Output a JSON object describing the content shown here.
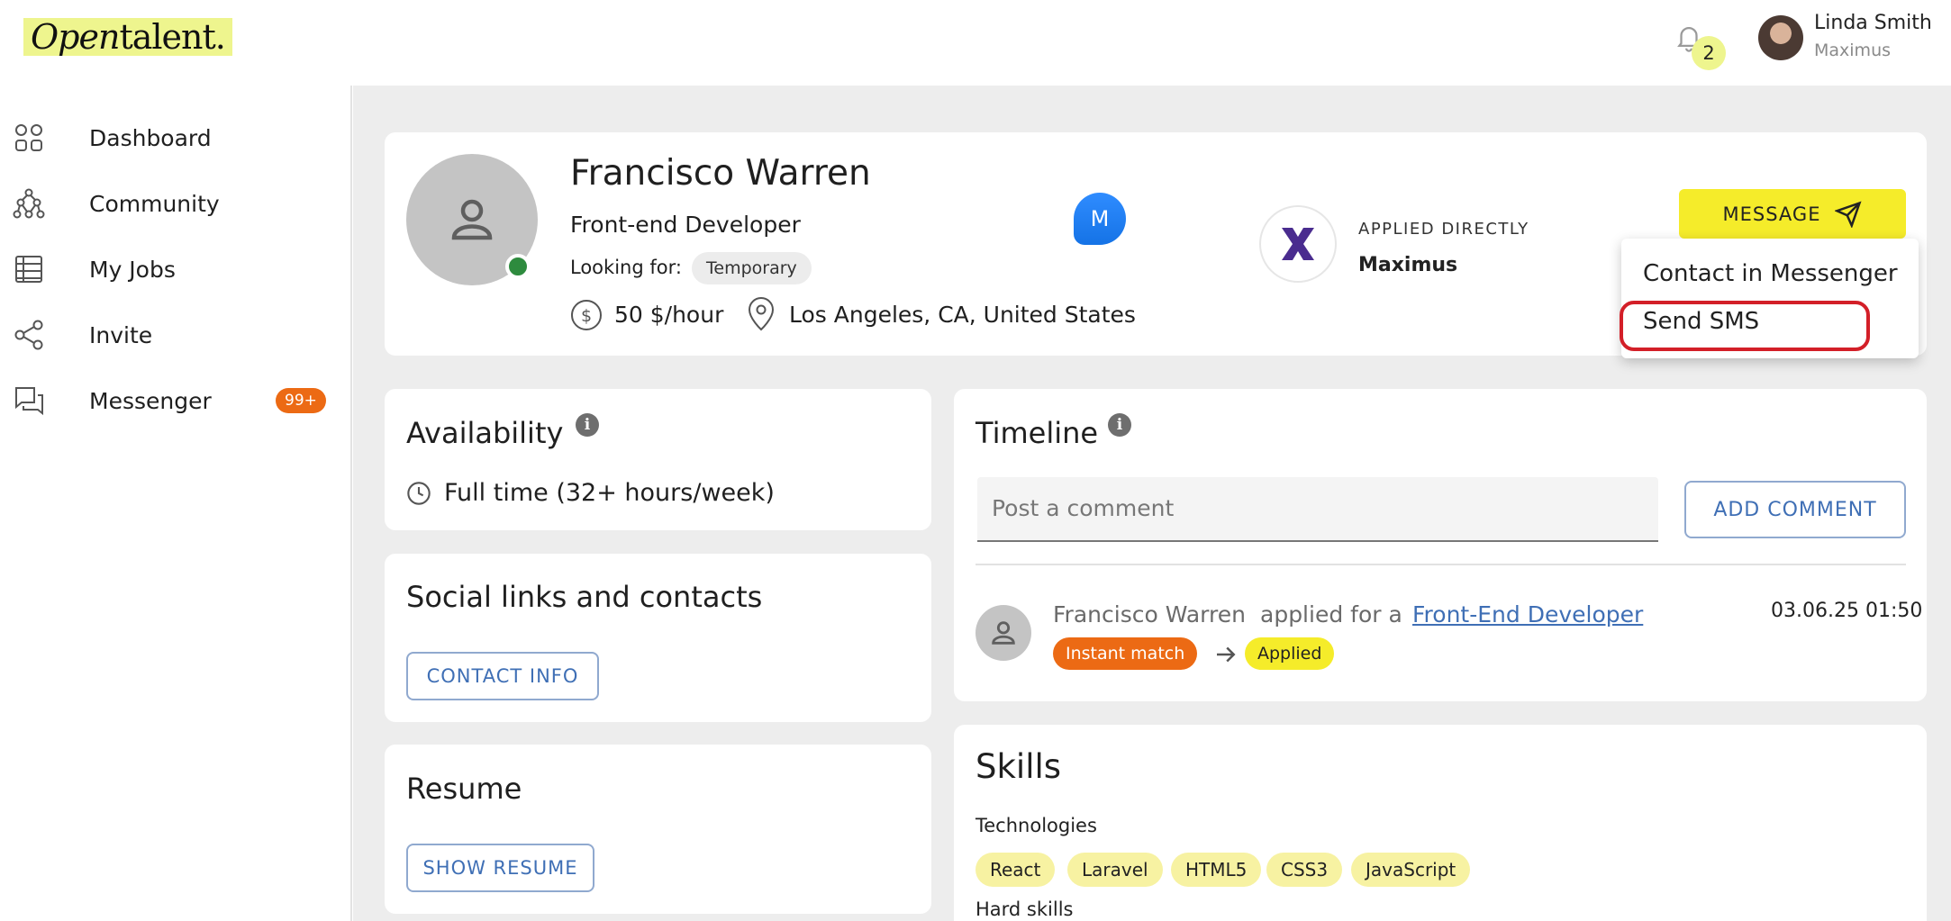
{
  "header": {
    "logo_text_italic": "Open",
    "logo_text_rest": "talent.",
    "notification_count": "2",
    "user_name": "Linda Smith",
    "user_org": "Maximus"
  },
  "sidebar": {
    "items": [
      {
        "label": "Dashboard",
        "icon": "dashboard-icon"
      },
      {
        "label": "Community",
        "icon": "community-icon"
      },
      {
        "label": "My Jobs",
        "icon": "jobs-icon"
      },
      {
        "label": "Invite",
        "icon": "share-icon"
      },
      {
        "label": "Messenger",
        "icon": "chat-icon",
        "badge": "99+"
      }
    ]
  },
  "profile": {
    "name": "Francisco Warren",
    "role": "Front-end Developer",
    "looking_label": "Looking for:",
    "looking_value": "Temporary",
    "rate": "50 $/hour",
    "location": "Los Angeles, CA, United States",
    "messenger_initial": "M",
    "applied_label": "APPLIED DIRECTLY",
    "applied_company": "Maximus",
    "message_button": "MESSAGE"
  },
  "dropdown": {
    "items": [
      "Contact in Messenger",
      "Send SMS"
    ]
  },
  "availability": {
    "title": "Availability",
    "value": "Full time (32+ hours/week)"
  },
  "social": {
    "title": "Social links and contacts",
    "button": "CONTACT INFO"
  },
  "resume": {
    "title": "Resume",
    "button": "SHOW RESUME"
  },
  "timeline": {
    "title": "Timeline",
    "comment_placeholder": "Post a comment",
    "add_comment_button": "ADD COMMENT",
    "entry": {
      "actor": "Francisco Warren",
      "action": "applied for a",
      "job_link": "Front-End Developer",
      "date": "03.06.25 01:50",
      "from_status": "Instant match",
      "to_status": "Applied"
    }
  },
  "skills": {
    "title": "Skills",
    "technologies_label": "Technologies",
    "technologies": [
      "React",
      "Laravel",
      "HTML5",
      "CSS3",
      "JavaScript"
    ],
    "hard_skills_label": "Hard skills"
  },
  "colors": {
    "accent_yellow": "#f5ec2a",
    "logo_highlight": "#eef58e",
    "badge_orange": "#ec6a14",
    "online_green": "#2e8b3e",
    "link_blue": "#3f6fb5",
    "highlight_red": "#d31f28"
  }
}
